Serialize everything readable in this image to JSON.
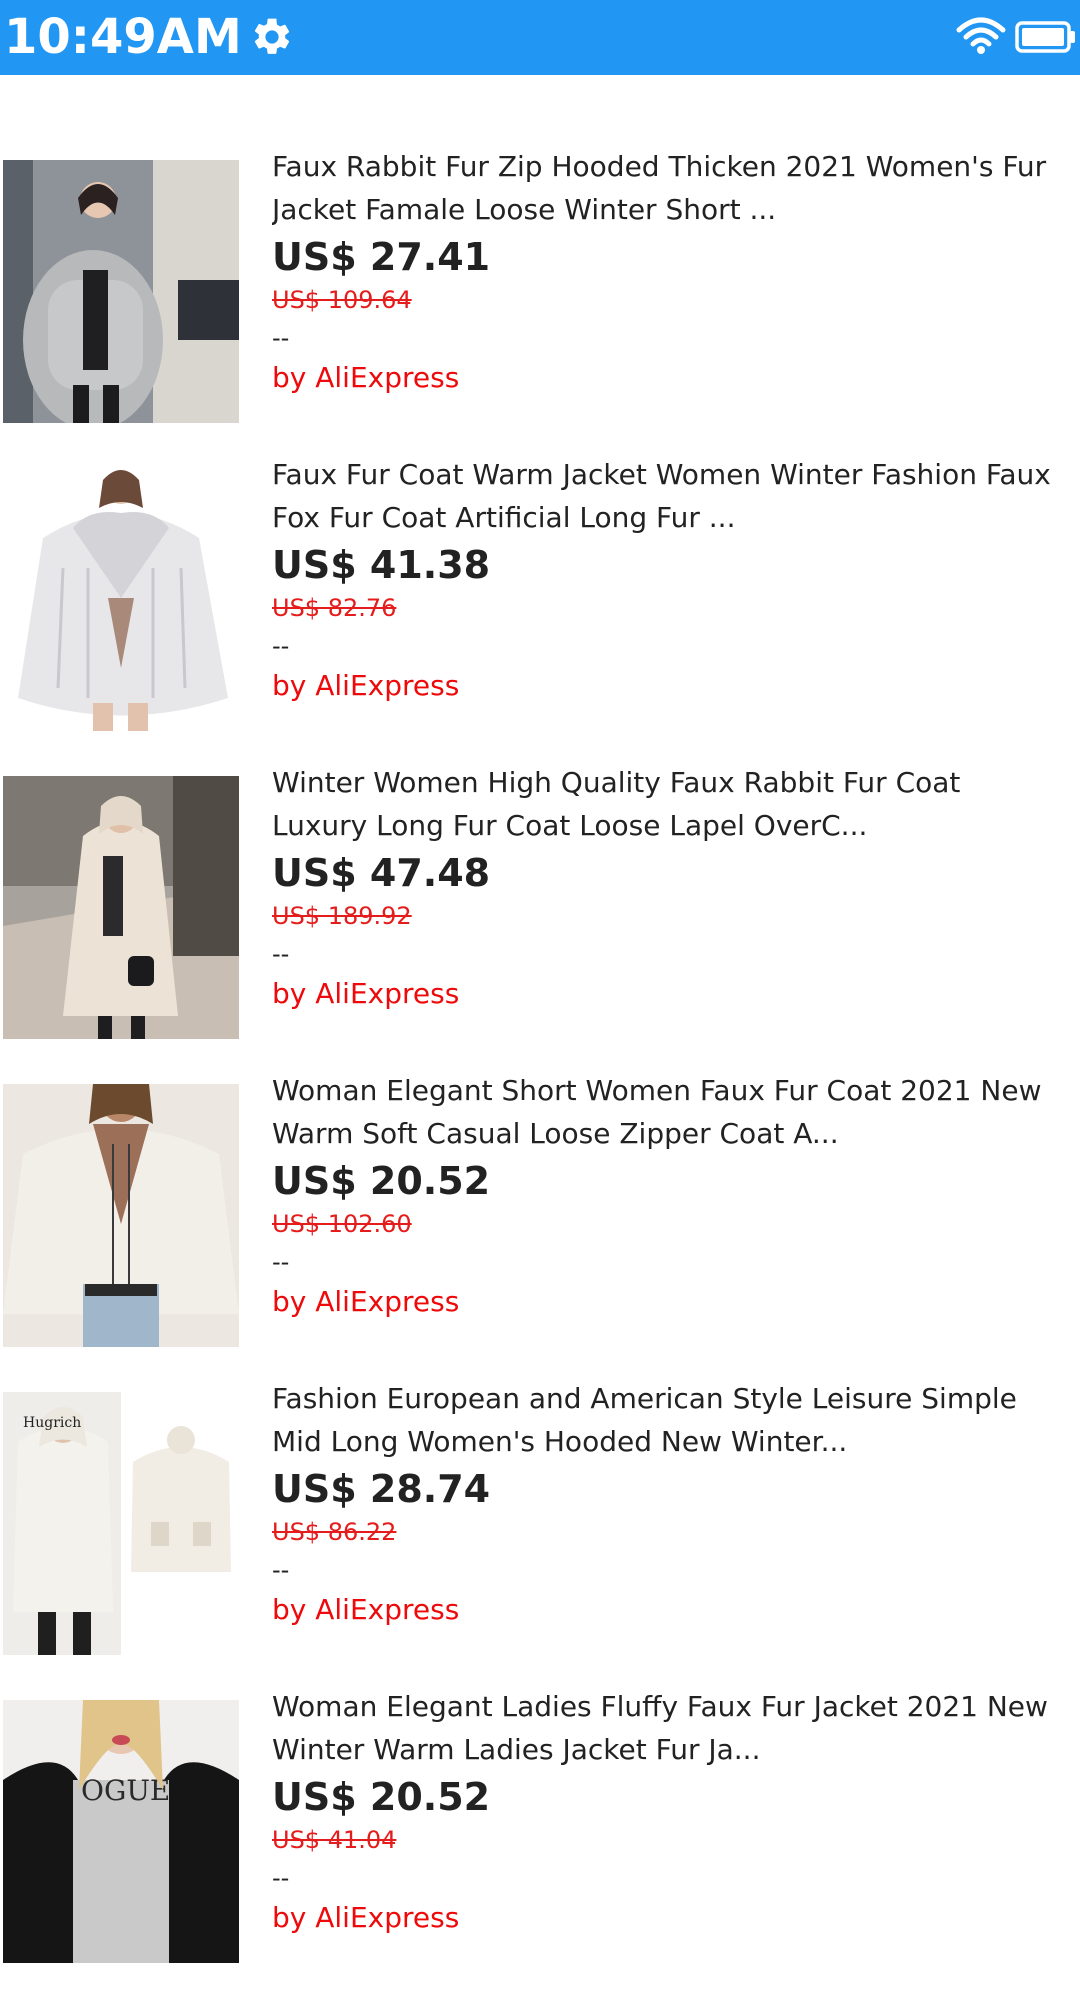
{
  "status_bar": {
    "time": "10:49AM",
    "color": "#2196f3",
    "icons": [
      "gear-icon",
      "wifi-icon",
      "battery-icon"
    ]
  },
  "products": [
    {
      "title_line1": "Faux Rabbit Fur Zip Hooded Thicken 2021 Women's Fur",
      "title_line2": "Jacket Famale Loose Winter Short ...",
      "price": "US$ 27.41",
      "original_price": "US$ 109.64",
      "rating": "--",
      "seller": "by AliExpress",
      "image": "grey-faux-fur-jacket-photo"
    },
    {
      "title_line1": "Faux Fur Coat Warm Jacket Women Winter Fashion Faux",
      "title_line2": "Fox Fur Coat Artificial Long Fur ...",
      "price": "US$ 41.38",
      "original_price": "US$ 82.76",
      "rating": "--",
      "seller": "by AliExpress",
      "image": "white-fox-fur-coat-photo"
    },
    {
      "title_line1": "Winter Women High Quality Faux Rabbit Fur Coat",
      "title_line2": "Luxury Long Fur Coat Loose Lapel OverC...",
      "price": "US$ 47.48",
      "original_price": "US$ 189.92",
      "rating": "--",
      "seller": "by AliExpress",
      "image": "long-beige-fur-coat-photo"
    },
    {
      "title_line1": "Woman Elegant Short Women Faux Fur Coat 2021 New",
      "title_line2": "Warm Soft Casual Loose Zipper Coat A...",
      "price": "US$ 20.52",
      "original_price": "US$ 102.60",
      "rating": "--",
      "seller": "by AliExpress",
      "image": "white-teddy-jacket-photo"
    },
    {
      "title_line1": "Fashion European and American Style Leisure Simple",
      "title_line2": "Mid Long Women's Hooded New Winter...",
      "price": "US$ 28.74",
      "original_price": "US$ 86.22",
      "rating": "--",
      "seller": "by AliExpress",
      "image": "white-hooded-coat-photo",
      "image_text": "Hugrich"
    },
    {
      "title_line1": "Woman Elegant Ladies Fluffy Faux Fur Jacket 2021 New",
      "title_line2": "Winter Warm Ladies Jacket Fur Ja...",
      "price": "US$ 20.52",
      "original_price": "US$ 41.04",
      "rating": "--",
      "seller": "by AliExpress",
      "image": "black-fluffy-fur-jacket-photo",
      "image_text": "OGUE"
    }
  ]
}
